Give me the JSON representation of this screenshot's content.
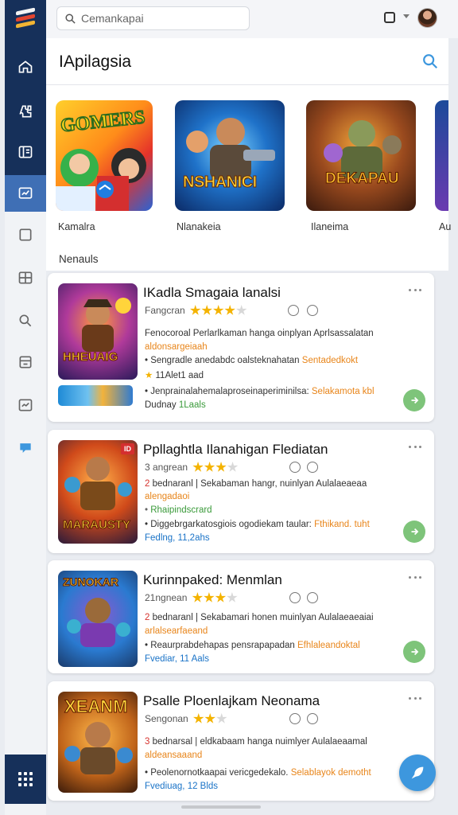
{
  "search": {
    "placeholder": "Cemankapai"
  },
  "page": {
    "title": "IApilagsia",
    "section_label": "Nenauls"
  },
  "featured": [
    {
      "label": "Kamalra",
      "art_text": "GOMERS"
    },
    {
      "label": "Nlanakeia",
      "art_text": "NSHANICI"
    },
    {
      "label": "Ilaneima",
      "art_text": "DEKAPAU"
    },
    {
      "label": "Au"
    }
  ],
  "apps": [
    {
      "title": "IKadla Smagaia lanalsi",
      "meta": "Fangcran",
      "rating": 4,
      "line1": "Fenocoroal  Perlarlkaman hanga oinplyan Aprlsassalatan",
      "line2": "aldonsargeiaah",
      "line3_prefix": "• Sengradle anedabdc oalsteknahatan",
      "line3_tag": "Sentadedkokt",
      "line4_star": "★",
      "line4": "11Alet1 aad",
      "line5_prefix": "• Jenprainalahemalaproseinaperiminilsa:",
      "line5_tag": "Selakamota kbl",
      "line6_prefix": "Dudnay",
      "line6_tag": "1Laals",
      "thumb_text": "HHEUAIG"
    },
    {
      "title": "Ppllaghtla Ilanahigan Flediatan",
      "meta": "3 angrean",
      "rating": 3,
      "line1_red": "2",
      "line1": " bednaranl  | Sekabaman hangr, nuinlyan Aulalaeaeaa",
      "line2": "alengadaoi",
      "line3": "Rhaipindscrard",
      "line4": "• Diggebrgarkatosgiois ogodiekam taular:",
      "line4_tag": "Fthikand. tuht",
      "line5": "Fedlng, 11,2ahs",
      "thumb_text": "MARAUSTY",
      "badge": "ID"
    },
    {
      "title": "Kurinnpaked: Menmlan",
      "meta": "21ngnean",
      "rating": 3,
      "line1_red": "2",
      "line1": " bednaranl  | Sekabamari honen muinlyan Aulalaeaeaiai",
      "line2": "arlalsearfaeand",
      "line3": "• Reaurprabdehapas pensrapapadan",
      "line3_tag": "Efhlaleandoktal",
      "line4": "Fvediar, 11 Aals",
      "thumb_text": "ZUNOKAR"
    },
    {
      "title": "Psalle Ploenlajkam Neonama",
      "meta": "Sengonan",
      "rating": 2,
      "line1_red": "3",
      "line1": " bednarsal  | eldkabaam hanga nuimlyer Aulalaeaamal",
      "line2": "aldeansaaand",
      "line3": "• Peolenornotkaapai vericgedekalo.",
      "line3_tag": "Selablayok demotht",
      "line4": "Fvediuag, 12 Blds",
      "thumb_text": "XEANM"
    }
  ]
}
